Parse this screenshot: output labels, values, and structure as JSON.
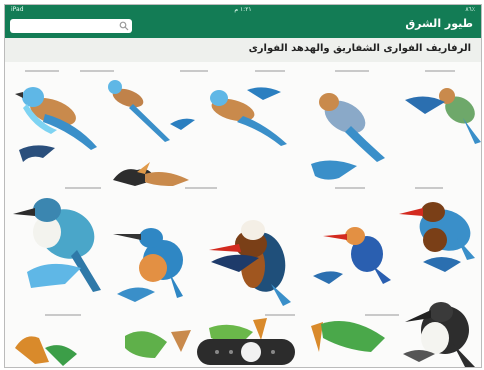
{
  "status_bar": {
    "time": "١:٢١ م",
    "left": "iPad",
    "right": "٨٦٪"
  },
  "app": {
    "title": "طيور الشرق",
    "search_placeholder": ""
  },
  "page": {
    "title": "الرفاريف الفوارى الشفاريق والهدهد الفوارى"
  },
  "pager": {
    "pages": 3,
    "current": 2
  },
  "colors": {
    "brand": "#137c55",
    "pager": "#2c2c2c"
  },
  "icons": [
    "search-icon"
  ]
}
